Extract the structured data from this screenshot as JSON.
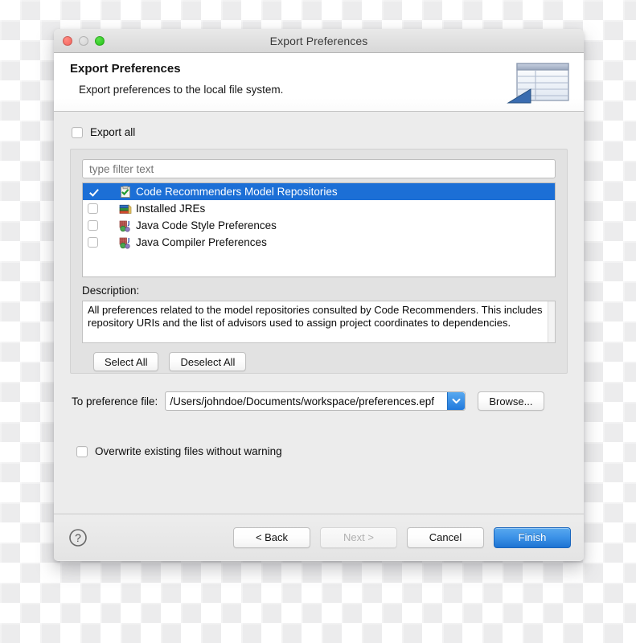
{
  "window": {
    "title": "Export Preferences",
    "traffic_lights": [
      "close-button",
      "minimize-button",
      "zoom-button"
    ]
  },
  "banner": {
    "title": "Export Preferences",
    "subtitle": "Export preferences to the local file system.",
    "icon": "export-table-icon"
  },
  "export_all": {
    "label": "Export all",
    "checked": false
  },
  "filter": {
    "placeholder": "type filter text",
    "value": ""
  },
  "tree": {
    "items": [
      {
        "label": "Code Recommenders Model Repositories",
        "checked": true,
        "selected": true,
        "icon": "repository-icon"
      },
      {
        "label": "Installed JREs",
        "checked": false,
        "selected": false,
        "icon": "jre-books-icon"
      },
      {
        "label": "Java Code Style Preferences",
        "checked": false,
        "selected": false,
        "icon": "java-preferences-icon"
      },
      {
        "label": "Java Compiler Preferences",
        "checked": false,
        "selected": false,
        "icon": "java-preferences-icon"
      }
    ]
  },
  "description": {
    "label": "Description:",
    "text": "All preferences related to the model repositories consulted by Code Recommenders. This includes repository URIs and the list of advisors used to assign project coordinates to dependencies."
  },
  "selection_buttons": {
    "select_all": "Select All",
    "deselect_all": "Deselect All"
  },
  "preference_file": {
    "label": "To preference file:",
    "value": "/Users/johndoe/Documents/workspace/preferences.epf",
    "dropdown_icon": "chevron-down-icon",
    "browse_label": "Browse..."
  },
  "overwrite": {
    "label": "Overwrite existing files without warning",
    "checked": false
  },
  "footer": {
    "help_icon": "help-question-icon",
    "back_label": "< Back",
    "next_label": "Next >",
    "cancel_label": "Cancel",
    "finish_label": "Finish"
  },
  "colors": {
    "selection_blue": "#1c6fd6",
    "primary_button_blue": "#3e94e8",
    "window_chrome": "#ececec",
    "group_panel": "#e2e2e2"
  }
}
